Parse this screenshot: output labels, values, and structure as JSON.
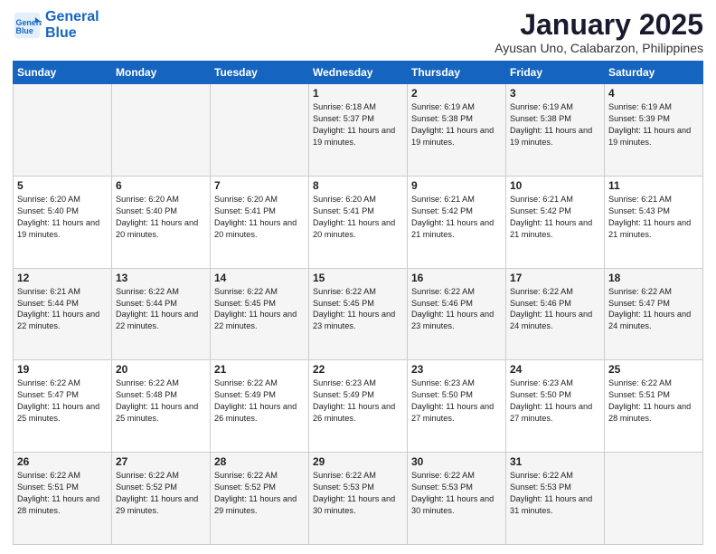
{
  "logo": {
    "line1": "General",
    "line2": "Blue"
  },
  "title": "January 2025",
  "subtitle": "Ayusan Uno, Calabarzon, Philippines",
  "headers": [
    "Sunday",
    "Monday",
    "Tuesday",
    "Wednesday",
    "Thursday",
    "Friday",
    "Saturday"
  ],
  "weeks": [
    [
      {
        "day": "",
        "info": ""
      },
      {
        "day": "",
        "info": ""
      },
      {
        "day": "",
        "info": ""
      },
      {
        "day": "1",
        "info": "Sunrise: 6:18 AM\nSunset: 5:37 PM\nDaylight: 11 hours and 19 minutes."
      },
      {
        "day": "2",
        "info": "Sunrise: 6:19 AM\nSunset: 5:38 PM\nDaylight: 11 hours and 19 minutes."
      },
      {
        "day": "3",
        "info": "Sunrise: 6:19 AM\nSunset: 5:38 PM\nDaylight: 11 hours and 19 minutes."
      },
      {
        "day": "4",
        "info": "Sunrise: 6:19 AM\nSunset: 5:39 PM\nDaylight: 11 hours and 19 minutes."
      }
    ],
    [
      {
        "day": "5",
        "info": "Sunrise: 6:20 AM\nSunset: 5:40 PM\nDaylight: 11 hours and 19 minutes."
      },
      {
        "day": "6",
        "info": "Sunrise: 6:20 AM\nSunset: 5:40 PM\nDaylight: 11 hours and 20 minutes."
      },
      {
        "day": "7",
        "info": "Sunrise: 6:20 AM\nSunset: 5:41 PM\nDaylight: 11 hours and 20 minutes."
      },
      {
        "day": "8",
        "info": "Sunrise: 6:20 AM\nSunset: 5:41 PM\nDaylight: 11 hours and 20 minutes."
      },
      {
        "day": "9",
        "info": "Sunrise: 6:21 AM\nSunset: 5:42 PM\nDaylight: 11 hours and 21 minutes."
      },
      {
        "day": "10",
        "info": "Sunrise: 6:21 AM\nSunset: 5:42 PM\nDaylight: 11 hours and 21 minutes."
      },
      {
        "day": "11",
        "info": "Sunrise: 6:21 AM\nSunset: 5:43 PM\nDaylight: 11 hours and 21 minutes."
      }
    ],
    [
      {
        "day": "12",
        "info": "Sunrise: 6:21 AM\nSunset: 5:44 PM\nDaylight: 11 hours and 22 minutes."
      },
      {
        "day": "13",
        "info": "Sunrise: 6:22 AM\nSunset: 5:44 PM\nDaylight: 11 hours and 22 minutes."
      },
      {
        "day": "14",
        "info": "Sunrise: 6:22 AM\nSunset: 5:45 PM\nDaylight: 11 hours and 22 minutes."
      },
      {
        "day": "15",
        "info": "Sunrise: 6:22 AM\nSunset: 5:45 PM\nDaylight: 11 hours and 23 minutes."
      },
      {
        "day": "16",
        "info": "Sunrise: 6:22 AM\nSunset: 5:46 PM\nDaylight: 11 hours and 23 minutes."
      },
      {
        "day": "17",
        "info": "Sunrise: 6:22 AM\nSunset: 5:46 PM\nDaylight: 11 hours and 24 minutes."
      },
      {
        "day": "18",
        "info": "Sunrise: 6:22 AM\nSunset: 5:47 PM\nDaylight: 11 hours and 24 minutes."
      }
    ],
    [
      {
        "day": "19",
        "info": "Sunrise: 6:22 AM\nSunset: 5:47 PM\nDaylight: 11 hours and 25 minutes."
      },
      {
        "day": "20",
        "info": "Sunrise: 6:22 AM\nSunset: 5:48 PM\nDaylight: 11 hours and 25 minutes."
      },
      {
        "day": "21",
        "info": "Sunrise: 6:22 AM\nSunset: 5:49 PM\nDaylight: 11 hours and 26 minutes."
      },
      {
        "day": "22",
        "info": "Sunrise: 6:23 AM\nSunset: 5:49 PM\nDaylight: 11 hours and 26 minutes."
      },
      {
        "day": "23",
        "info": "Sunrise: 6:23 AM\nSunset: 5:50 PM\nDaylight: 11 hours and 27 minutes."
      },
      {
        "day": "24",
        "info": "Sunrise: 6:23 AM\nSunset: 5:50 PM\nDaylight: 11 hours and 27 minutes."
      },
      {
        "day": "25",
        "info": "Sunrise: 6:22 AM\nSunset: 5:51 PM\nDaylight: 11 hours and 28 minutes."
      }
    ],
    [
      {
        "day": "26",
        "info": "Sunrise: 6:22 AM\nSunset: 5:51 PM\nDaylight: 11 hours and 28 minutes."
      },
      {
        "day": "27",
        "info": "Sunrise: 6:22 AM\nSunset: 5:52 PM\nDaylight: 11 hours and 29 minutes."
      },
      {
        "day": "28",
        "info": "Sunrise: 6:22 AM\nSunset: 5:52 PM\nDaylight: 11 hours and 29 minutes."
      },
      {
        "day": "29",
        "info": "Sunrise: 6:22 AM\nSunset: 5:53 PM\nDaylight: 11 hours and 30 minutes."
      },
      {
        "day": "30",
        "info": "Sunrise: 6:22 AM\nSunset: 5:53 PM\nDaylight: 11 hours and 30 minutes."
      },
      {
        "day": "31",
        "info": "Sunrise: 6:22 AM\nSunset: 5:53 PM\nDaylight: 11 hours and 31 minutes."
      },
      {
        "day": "",
        "info": ""
      }
    ]
  ]
}
